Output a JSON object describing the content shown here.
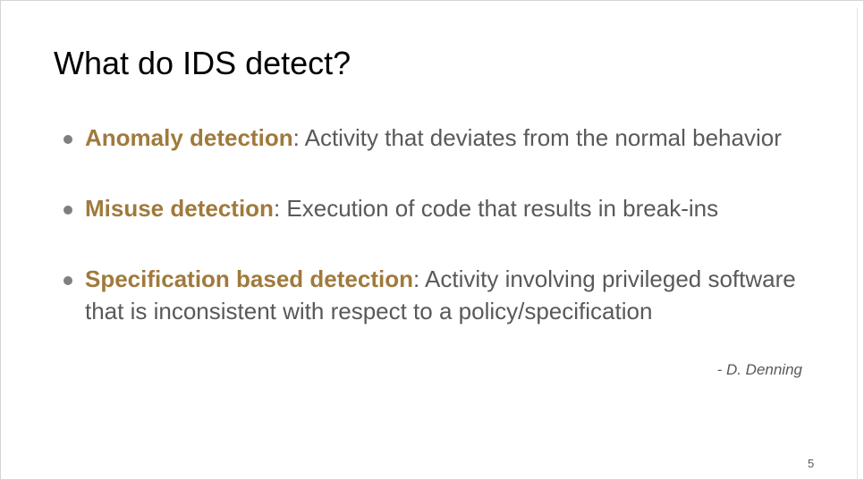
{
  "slide": {
    "title": "What do IDS detect?",
    "bullets": [
      {
        "term": "Anomaly detection",
        "separator": ": ",
        "description": "Activity that deviates from the normal behavior"
      },
      {
        "term": "Misuse detection",
        "separator": ": ",
        "description": "Execution of code that results in break-ins"
      },
      {
        "term": "Specification based detection",
        "separator": ": ",
        "description": "Activity involving privileged software that is inconsistent with respect to a policy/specification"
      }
    ],
    "attribution": "- D. Denning",
    "page_number": "5"
  },
  "colors": {
    "title": "#000000",
    "body_text": "#595959",
    "term_accent": "#a07a3c",
    "bullet_dot": "#7f7f7f"
  }
}
